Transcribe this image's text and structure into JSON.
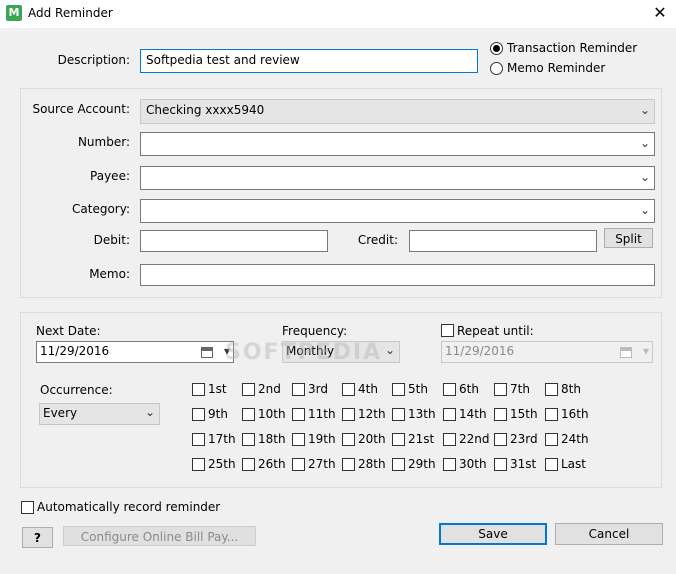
{
  "window": {
    "title": "Add Reminder",
    "close_glyph": "✕",
    "app_icon_letter": "M"
  },
  "description": {
    "label": "Description:",
    "value": "Softpedia test and review"
  },
  "reminder_type": {
    "transaction": "Transaction Reminder",
    "memo": "Memo Reminder",
    "selected": "transaction"
  },
  "transaction": {
    "source_account": {
      "label": "Source Account:",
      "value": "Checking xxxx5940"
    },
    "number": {
      "label": "Number:",
      "value": ""
    },
    "payee": {
      "label": "Payee:",
      "value": ""
    },
    "category": {
      "label": "Category:",
      "value": ""
    },
    "debit": {
      "label": "Debit:",
      "value": ""
    },
    "credit": {
      "label": "Credit:",
      "value": ""
    },
    "split_label": "Split",
    "memo": {
      "label": "Memo:",
      "value": ""
    }
  },
  "schedule": {
    "next_date": {
      "label": "Next Date:",
      "value": "11/29/2016"
    },
    "frequency": {
      "label": "Frequency:",
      "value": "Monthly"
    },
    "repeat_until": {
      "label": "Repeat until:",
      "value": "11/29/2016"
    },
    "occurrence": {
      "label": "Occurrence:",
      "value": "Every"
    },
    "days": [
      [
        "1st",
        "2nd",
        "3rd",
        "4th",
        "5th",
        "6th",
        "7th",
        "8th"
      ],
      [
        "9th",
        "10th",
        "11th",
        "12th",
        "13th",
        "14th",
        "15th",
        "16th"
      ],
      [
        "17th",
        "18th",
        "19th",
        "20th",
        "21st",
        "22nd",
        "23rd",
        "24th"
      ],
      [
        "25th",
        "26th",
        "27th",
        "28th",
        "29th",
        "30th",
        "31st",
        "Last"
      ]
    ]
  },
  "auto_record": {
    "label": "Automatically record reminder"
  },
  "buttons": {
    "help": "?",
    "configure": "Configure Online Bill Pay...",
    "save": "Save",
    "cancel": "Cancel"
  },
  "watermark": "SOFTPEDIA",
  "colors": {
    "accent": "#0078d7",
    "app_icon": "#3aa757"
  }
}
